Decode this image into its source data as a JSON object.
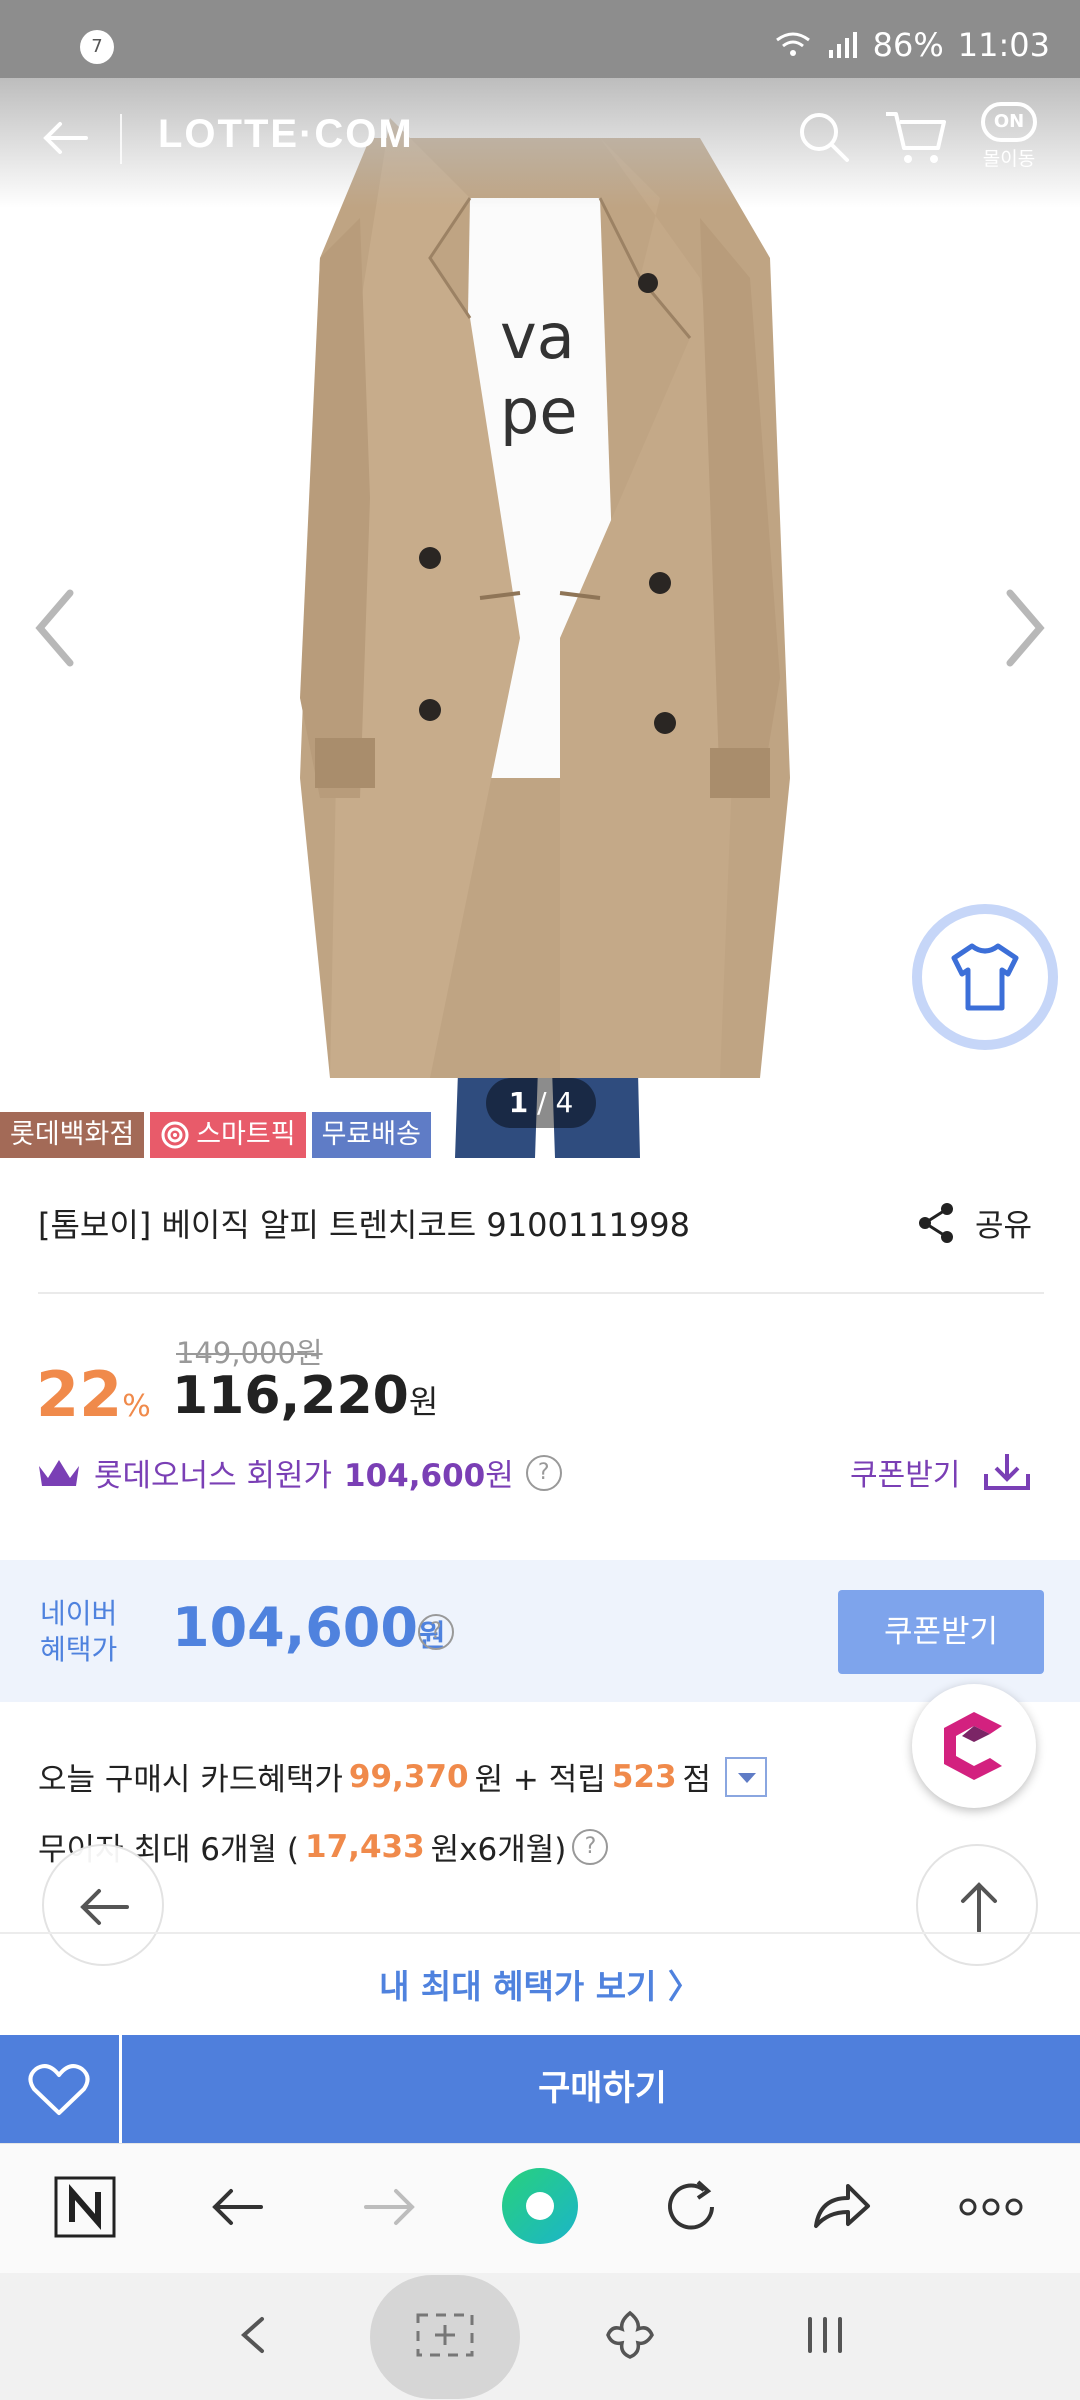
{
  "status_bar": {
    "notification_count": "7",
    "battery": "86%",
    "time": "11:03"
  },
  "header": {
    "logo": "LOTTE·COM",
    "on_badge": "ON",
    "on_label": "몰이동"
  },
  "gallery": {
    "current": "1",
    "total": "4",
    "separator": "/"
  },
  "tags": {
    "dept": "롯데백화점",
    "pick": "스마트픽",
    "ship": "무료배송"
  },
  "product": {
    "title": "[톰보이] 베이직 알피 트렌치코트 9100111998",
    "share_label": "공유"
  },
  "price": {
    "original": "149,000원",
    "discount_rate": "22",
    "rate_unit": "%",
    "sale_price": "116,220",
    "currency": "원"
  },
  "member": {
    "label": "롯데오너스 회원가",
    "price": "104,600",
    "currency": "원",
    "help": "?",
    "coupon_link": "쿠폰받기"
  },
  "naver": {
    "label_line1": "네이버",
    "label_line2": "혜택가",
    "price": "104,600",
    "currency": "원",
    "help": "?",
    "coupon_button": "쿠폰받기"
  },
  "card_benefit": {
    "prefix": "오늘 구매시 카드혜택가",
    "price": "99,370",
    "mid": "원 + 적립",
    "points": "523",
    "suffix": "점"
  },
  "installment": {
    "prefix": "무이자 최대 6개월 (",
    "amount": "17,433",
    "suffix": "원x6개월)",
    "help": "?"
  },
  "benefit_link": "내 최대 혜택가 보기 〉",
  "buy_button": "구매하기",
  "colors": {
    "accent_blue": "#4f7fdc",
    "discount_orange": "#f08a4b",
    "member_purple": "#7a3fb5"
  },
  "icons": [
    "back-arrow-icon",
    "search-icon",
    "cart-icon",
    "share-icon",
    "heart-icon",
    "shirt-icon",
    "crown-icon",
    "download-icon",
    "scroll-top-icon",
    "refresh-icon",
    "forward-icon",
    "more-icon"
  ]
}
